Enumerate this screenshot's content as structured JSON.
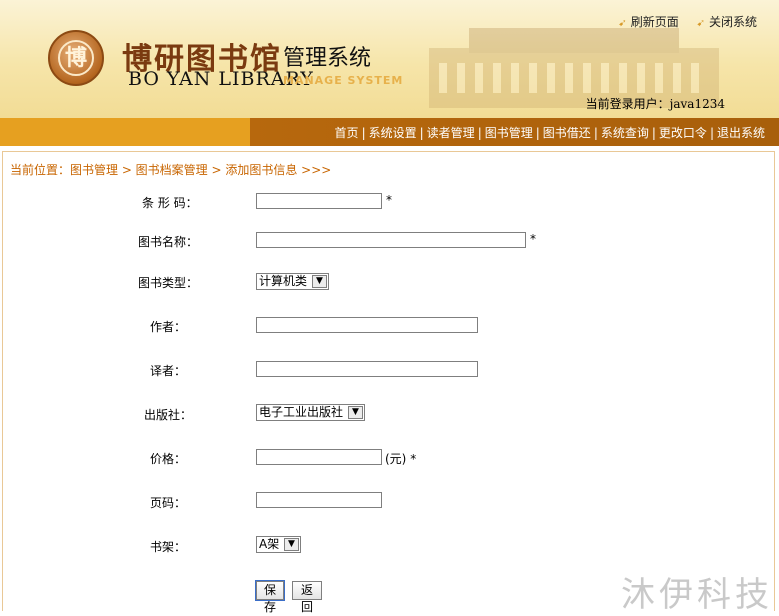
{
  "header": {
    "logo_char": "博",
    "title_cn": "博研图书馆",
    "title_sys": "管理系统",
    "title_en": "BO YAN LIBRARY",
    "title_en_small": "MANAGE SYSTEM",
    "refresh_label": "刷新页面",
    "close_label": "关闭系统",
    "user_label": "当前登录用户：",
    "user_name": "java1234"
  },
  "nav": {
    "items": [
      "首页",
      "系统设置",
      "读者管理",
      "图书管理",
      "图书借还",
      "系统查询",
      "更改口令",
      "退出系统"
    ]
  },
  "breadcrumb": "当前位置：图书管理 > 图书档案管理 > 添加图书信息 >>>",
  "form": {
    "barcode_label": "条 形 码：",
    "bookname_label": "图书名称：",
    "booktype_label": "图书类型：",
    "booktype_value": "计算机类",
    "author_label": "作者：",
    "translator_label": "译者：",
    "publisher_label": "出版社：",
    "publisher_value": "电子工业出版社",
    "price_label": "价格：",
    "price_unit": "(元)",
    "pages_label": "页码：",
    "shelf_label": "书架：",
    "shelf_value": "A架",
    "required_mark": "*",
    "save_label": "保存",
    "back_label": "返回"
  },
  "watermark": "沐伊科技",
  "colors": {
    "nav_left": "#e6a020",
    "nav_right": "#b7680d",
    "breadcrumb": "#c86500"
  }
}
